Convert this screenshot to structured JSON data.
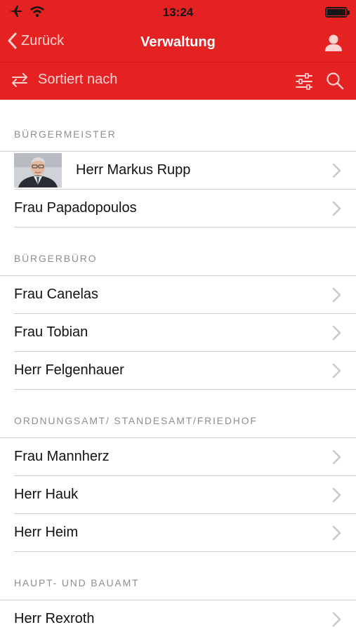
{
  "status_bar": {
    "time": "13:24"
  },
  "nav_bar": {
    "back_label": "Zurück",
    "title": "Verwaltung"
  },
  "toolbar": {
    "sort_label": "Sortiert nach"
  },
  "sections": [
    {
      "header": "BÜRGERMEISTER",
      "items": [
        {
          "name": "Herr Markus Rupp",
          "has_photo": true
        },
        {
          "name": "Frau Papadopoulos"
        }
      ]
    },
    {
      "header": "BÜRGERBÜRO",
      "items": [
        {
          "name": "Frau Canelas"
        },
        {
          "name": "Frau Tobian"
        },
        {
          "name": "Herr Felgenhauer"
        }
      ]
    },
    {
      "header": "ORDNUNGSAMT/ STANDESAMT/FRIEDHOF",
      "items": [
        {
          "name": "Frau Mannherz"
        },
        {
          "name": "Herr Hauk"
        },
        {
          "name": "Herr Heim"
        }
      ]
    },
    {
      "header": "HAUPT- UND BAUAMT",
      "items": [
        {
          "name": "Herr Rexroth"
        }
      ]
    }
  ],
  "colors": {
    "brand_red": "#e52222",
    "text": "#111111",
    "section_header": "#8e8e8e",
    "chevron": "#c7c7cc"
  },
  "icons": [
    "airplane-icon",
    "wifi-icon",
    "battery-icon",
    "chevron-left-icon",
    "user-icon",
    "swap-icon",
    "filter-sliders-icon",
    "search-icon",
    "chevron-right-icon"
  ]
}
